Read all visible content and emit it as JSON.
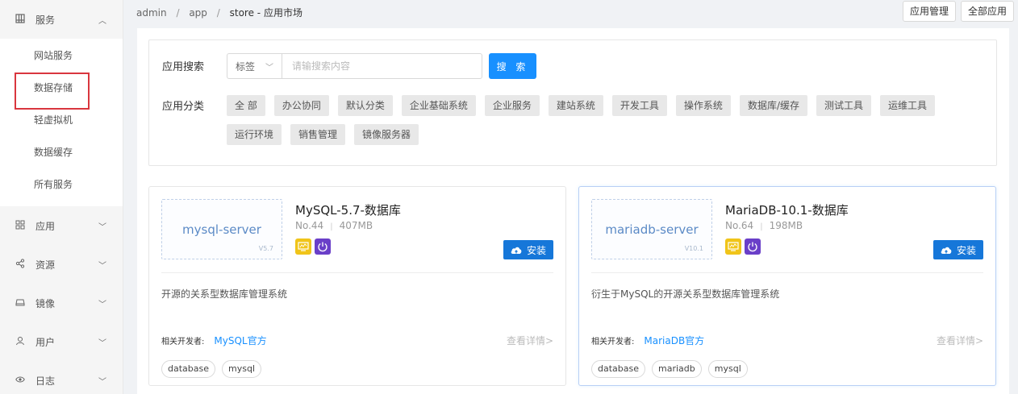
{
  "sidebar": {
    "service_menu": {
      "icon": "server-icon",
      "label": "服务",
      "expanded": true
    },
    "service_items": [
      {
        "label": "网站服务",
        "active": false
      },
      {
        "label": "数据存储",
        "active": true
      },
      {
        "label": "轻虚拟机",
        "active": false
      },
      {
        "label": "数据缓存",
        "active": false
      },
      {
        "label": "所有服务",
        "active": false
      }
    ],
    "app_menu": {
      "icon": "grid-icon",
      "label": "应用"
    },
    "resource_menu": {
      "icon": "share-icon",
      "label": "资源"
    },
    "image_menu": {
      "icon": "disk-icon",
      "label": "镜像"
    },
    "user_menu": {
      "icon": "user-icon",
      "label": "用户"
    },
    "log_menu": {
      "icon": "eye-icon",
      "label": "日志"
    }
  },
  "breadcrumb": {
    "items": [
      "admin",
      "app"
    ],
    "current": "store",
    "current_suffix": "应用市场",
    "separator": "/"
  },
  "top_buttons": {
    "manage": "应用管理",
    "all": "全部应用"
  },
  "search": {
    "label": "应用搜索",
    "select_value": "标签",
    "placeholder": "请输搜索内容",
    "button": "搜 索"
  },
  "categories": {
    "label": "应用分类",
    "items": [
      "全 部",
      "办公协同",
      "默认分类",
      "企业基础系统",
      "企业服务",
      "建站系统",
      "开发工具",
      "操作系统",
      "数据库/缓存",
      "测试工具",
      "运维工具",
      "运行环境",
      "销售管理",
      "镜像服务器"
    ]
  },
  "apps": [
    {
      "logo_name": "mysql-server",
      "logo_version": "V5.7",
      "title": "MySQL-5.7-数据库",
      "number": "No.44",
      "size": "407MB",
      "install_label": "安装",
      "description": "开源的关系型数据库管理系统",
      "developer_label": "相关开发者:",
      "developer": "MySQL官方",
      "detail_label": "查看详情>",
      "tags": [
        "database",
        "mysql"
      ]
    },
    {
      "logo_name": "mariadb-server",
      "logo_version": "V10.1",
      "title": "MariaDB-10.1-数据库",
      "number": "No.64",
      "size": "198MB",
      "install_label": "安装",
      "description": "衍生于MySQL的开源关系型数据库管理系统",
      "developer_label": "相关开发者:",
      "developer": "MariaDB官方",
      "detail_label": "查看详情>",
      "tags": [
        "database",
        "mariadb",
        "mysql"
      ]
    }
  ],
  "colors": {
    "primary": "#1890ff",
    "install": "#1677d9",
    "highlight_border": "#d9363e",
    "badge_yellow": "#f0c419",
    "badge_purple": "#6a3fc8"
  }
}
